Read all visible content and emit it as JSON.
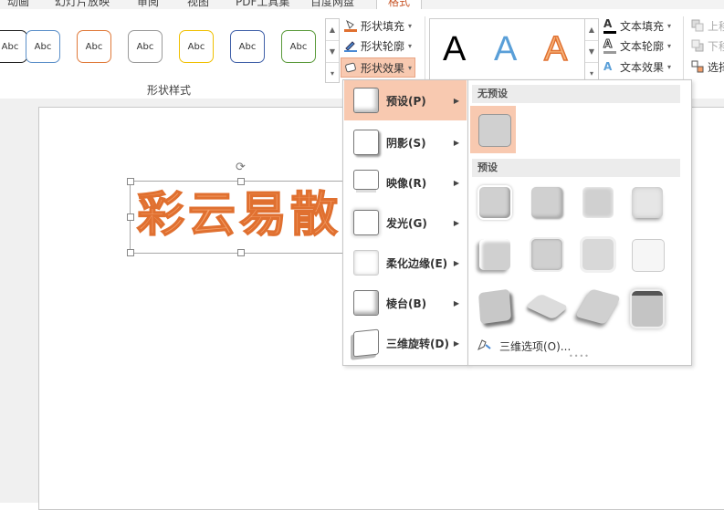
{
  "tabs": [
    "动画",
    "幻灯片放映",
    "审阅",
    "视图",
    "PDF工具集",
    "百度网盘",
    "格式"
  ],
  "shape_styles": {
    "swatch_text": "Abc",
    "swatch_borders": [
      "#222222",
      "#5b8fc9",
      "#e07a3a",
      "#9a9a9a",
      "#f0c000",
      "#4060a8",
      "#5a9a3a"
    ],
    "group_label": "形状样式"
  },
  "shape_commands": {
    "fill": "形状填充",
    "outline": "形状轮廓",
    "effects": "形状效果"
  },
  "wordart": {
    "letters": [
      {
        "char": "A",
        "color": "#000000"
      },
      {
        "char": "A",
        "color": "#5a9fd8"
      },
      {
        "char": "A",
        "color": "#f7b37a"
      }
    ],
    "fill": "文本填充",
    "outline": "文本轮廓",
    "effects": "文本效果"
  },
  "arrange": {
    "bring_forward": "上移",
    "send_backward": "下移",
    "select": "选择"
  },
  "slide": {
    "art_text": "彩云易散"
  },
  "effects_menu": [
    {
      "label": "预设(P)",
      "highlighted": true
    },
    {
      "label": "阴影(S)",
      "highlighted": false
    },
    {
      "label": "映像(R)",
      "highlighted": false
    },
    {
      "label": "发光(G)",
      "highlighted": false
    },
    {
      "label": "柔化边缘(E)",
      "highlighted": false
    },
    {
      "label": "棱台(B)",
      "highlighted": false
    },
    {
      "label": "三维旋转(D)",
      "highlighted": false
    }
  ],
  "preset_submenu": {
    "no_preset_header": "无预设",
    "preset_header": "预设",
    "three_d_options": "三维选项(O)..."
  },
  "colors": {
    "accent": "#f8c9b0",
    "active_tab_text": "#c8572a",
    "art_fill": "#f5a06a",
    "art_stroke": "#e07030"
  }
}
